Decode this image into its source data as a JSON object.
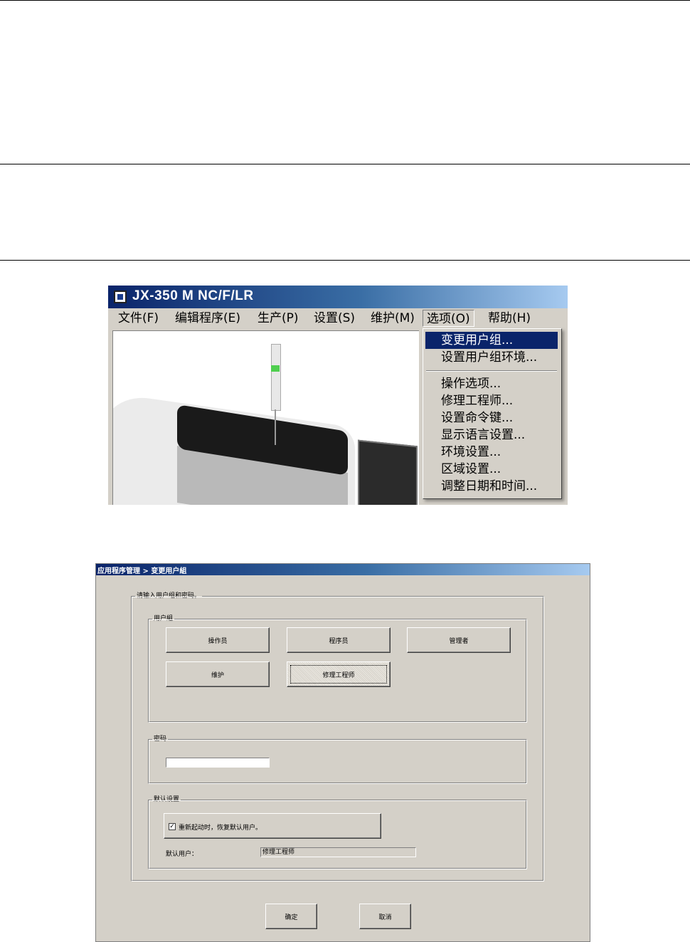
{
  "app_window": {
    "title": "JX-350 M NC/F/LR",
    "menubar": [
      {
        "label": "文件(F)",
        "state": "normal"
      },
      {
        "label": "编辑程序(E)",
        "state": "normal"
      },
      {
        "label": "生产(P)",
        "state": "normal"
      },
      {
        "label": "设置(S)",
        "state": "normal"
      },
      {
        "label": "维护(M)",
        "state": "normal"
      },
      {
        "label": "选项(O)",
        "state": "open"
      },
      {
        "label": "帮助(H)",
        "state": "normal"
      }
    ],
    "options_menu": {
      "group1": [
        "变更用户组...",
        "设置用户组环境..."
      ],
      "group2": [
        "操作选项...",
        "修理工程师...",
        "设置命令键...",
        "显示语言设置...",
        "环境设置...",
        "区域设置...",
        "调整日期和时间..."
      ],
      "highlighted": "变更用户组..."
    },
    "colors": {
      "title_bar": "#0a246a",
      "menu_highlight": "#0a246a",
      "status_lamp": "#4fcf4f"
    }
  },
  "dialog": {
    "title": "应用程序管理 > 变更用户組",
    "main_group_label": "请输入用户组和密码。",
    "user_group": {
      "label": "用户組",
      "buttons": [
        "操作员",
        "程序员",
        "管理者",
        "维护",
        "修理工程师"
      ],
      "selected": "修理工程师"
    },
    "password": {
      "label": "密码",
      "value": ""
    },
    "default_settings": {
      "label": "默认设置",
      "restore_checkbox_label": "重新起动时，恢复默认用户。",
      "restore_checked": true,
      "check_mark": "✓",
      "default_user_label": "默认用户：",
      "default_user_value": "修理工程师"
    },
    "ok_label": "确定",
    "cancel_label": "取消"
  }
}
